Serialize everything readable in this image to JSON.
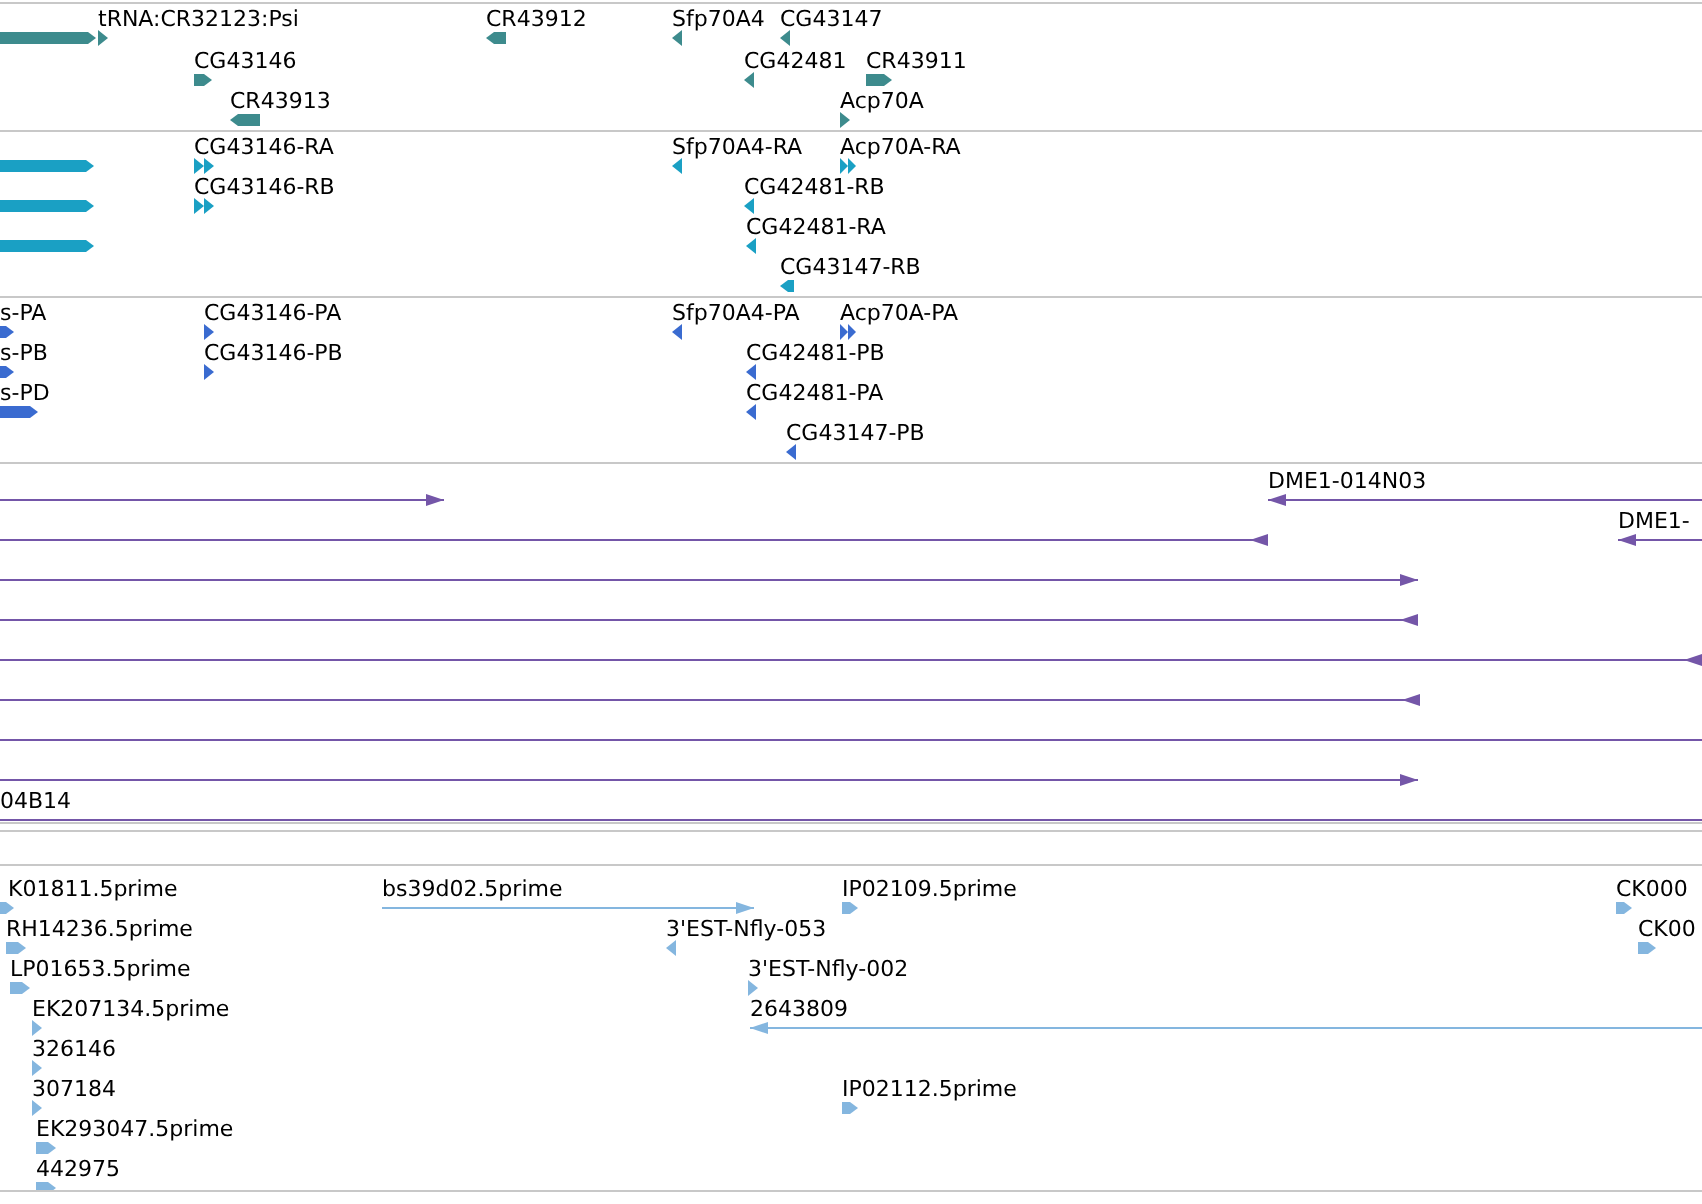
{
  "tracks": [
    {
      "kind": "gene",
      "features": [
        {
          "kind": "bar",
          "reverse": false
        },
        {
          "label": "tRNA:CR32123:Psi",
          "kind": "tri",
          "reverse": false
        },
        {
          "label": "CR43912",
          "kind": "bar",
          "reverse": true
        },
        {
          "label": "Sfp70A4",
          "kind": "tri",
          "reverse": true
        },
        {
          "label": "CG43147",
          "kind": "tri",
          "reverse": true
        },
        {
          "label": "CG43146",
          "kind": "bar",
          "reverse": false
        },
        {
          "label": "CG42481",
          "kind": "tri",
          "reverse": true
        },
        {
          "label": "CR43911",
          "kind": "bar",
          "reverse": false
        },
        {
          "label": "CR43913",
          "kind": "bar",
          "reverse": true
        },
        {
          "label": "Acp70A",
          "kind": "tri",
          "reverse": false
        }
      ]
    },
    {
      "kind": "transcript",
      "features": [
        {
          "kind": "bar",
          "reverse": false
        },
        {
          "kind": "bar",
          "reverse": false
        },
        {
          "kind": "bar",
          "reverse": false
        },
        {
          "label": "CG43146-RA",
          "kind": "double",
          "reverse": false
        },
        {
          "label": "CG43146-RB",
          "kind": "double",
          "reverse": false
        },
        {
          "label": "Sfp70A4-RA",
          "kind": "tri",
          "reverse": true
        },
        {
          "label": "Acp70A-RA",
          "kind": "double",
          "reverse": false
        },
        {
          "label": "CG42481-RB",
          "kind": "tri",
          "reverse": true
        },
        {
          "label": "CG42481-RA",
          "kind": "tri",
          "reverse": true
        },
        {
          "label": "CG43147-RB",
          "kind": "bar",
          "reverse": true
        }
      ]
    },
    {
      "kind": "protein",
      "features": [
        {
          "label": "s-PA",
          "kind": "bar",
          "reverse": false
        },
        {
          "label": "s-PB",
          "kind": "bar",
          "reverse": false
        },
        {
          "label": "s-PD",
          "kind": "bar",
          "reverse": false
        },
        {
          "label": "CG43146-PA",
          "kind": "tri",
          "reverse": false
        },
        {
          "label": "CG43146-PB",
          "kind": "tri",
          "reverse": false
        },
        {
          "label": "Sfp70A4-PA",
          "kind": "tri",
          "reverse": true
        },
        {
          "label": "Acp70A-PA",
          "kind": "double",
          "reverse": false
        },
        {
          "label": "CG42481-PB",
          "kind": "tri",
          "reverse": true
        },
        {
          "label": "CG42481-PA",
          "kind": "tri",
          "reverse": true
        },
        {
          "label": "CG43147-PB",
          "kind": "tri",
          "reverse": true
        }
      ]
    },
    {
      "kind": "clone",
      "features": [
        {
          "kind": "line",
          "reverse": false
        },
        {
          "label": "DME1-014N03",
          "kind": "line",
          "reverse": true
        },
        {
          "kind": "line",
          "reverse": true
        },
        {
          "label": "DME1-",
          "kind": "line",
          "reverse": true
        },
        {
          "kind": "line",
          "reverse": false
        },
        {
          "kind": "line",
          "reverse": true
        },
        {
          "kind": "line",
          "reverse": true
        },
        {
          "kind": "line",
          "reverse": true
        },
        {
          "kind": "line"
        },
        {
          "kind": "line",
          "reverse": false
        },
        {
          "label": "04B14",
          "kind": "line"
        }
      ]
    },
    {
      "kind": "est",
      "features": [
        {
          "label": "K01811.5prime",
          "kind": "bar",
          "reverse": false
        },
        {
          "label": "RH14236.5prime",
          "kind": "bar",
          "reverse": false
        },
        {
          "label": "LP01653.5prime",
          "kind": "bar",
          "reverse": false
        },
        {
          "label": "EK207134.5prime",
          "kind": "tri",
          "reverse": false
        },
        {
          "label": "326146",
          "kind": "tri",
          "reverse": false
        },
        {
          "label": "307184",
          "kind": "tri",
          "reverse": false
        },
        {
          "label": "EK293047.5prime",
          "kind": "bar",
          "reverse": false
        },
        {
          "label": "442975",
          "kind": "bar",
          "reverse": false
        },
        {
          "label": "bs39d02.5prime",
          "kind": "line",
          "reverse": false
        },
        {
          "label": "3'EST-Nfly-053",
          "kind": "tri",
          "reverse": true
        },
        {
          "label": "3'EST-Nfly-002",
          "kind": "tri",
          "reverse": false
        },
        {
          "label": "2643809",
          "kind": "line",
          "reverse": true
        },
        {
          "label": "IP02109.5prime",
          "kind": "bar",
          "reverse": false
        },
        {
          "label": "IP02112.5prime",
          "kind": "bar",
          "reverse": false
        },
        {
          "label": "CK000",
          "kind": "bar",
          "reverse": false
        },
        {
          "label": "CK00",
          "kind": "bar",
          "reverse": false
        }
      ]
    }
  ]
}
